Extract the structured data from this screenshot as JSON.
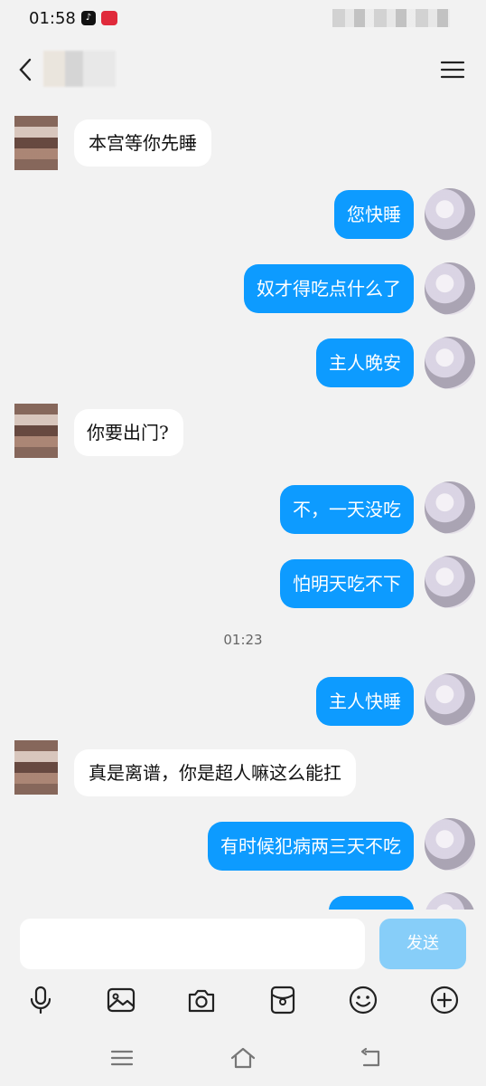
{
  "status_bar": {
    "time": "01:58"
  },
  "header": {
    "menu_icon": "menu-icon",
    "back_icon": "back-chevron-icon"
  },
  "messages": [
    {
      "side": "left",
      "text": "本宫等你先睡"
    },
    {
      "side": "right",
      "text": "您快睡"
    },
    {
      "side": "right",
      "text": "奴才得吃点什么了"
    },
    {
      "side": "right",
      "text": "主人晚安"
    },
    {
      "side": "left",
      "text": "你要出门?"
    },
    {
      "side": "right",
      "text": "不，一天没吃"
    },
    {
      "side": "right",
      "text": "怕明天吃不下"
    },
    {
      "side": "time",
      "text": "01:23"
    },
    {
      "side": "right",
      "text": "主人快睡"
    },
    {
      "side": "left",
      "text": "真是离谱，你是超人嘛这么能扛"
    },
    {
      "side": "right",
      "text": "有时候犯病两三天不吃"
    },
    {
      "side": "right",
      "text": ""
    }
  ],
  "input": {
    "send_label": "发送"
  },
  "toolbar": {
    "icons": [
      "microphone-icon",
      "image-icon",
      "camera-icon",
      "red-packet-icon",
      "emoji-icon",
      "plus-icon"
    ]
  },
  "colors": {
    "bubble_right": "#0d9bff",
    "bubble_left": "#ffffff",
    "background": "#f2f2f2",
    "send_button": "#87cef9"
  }
}
